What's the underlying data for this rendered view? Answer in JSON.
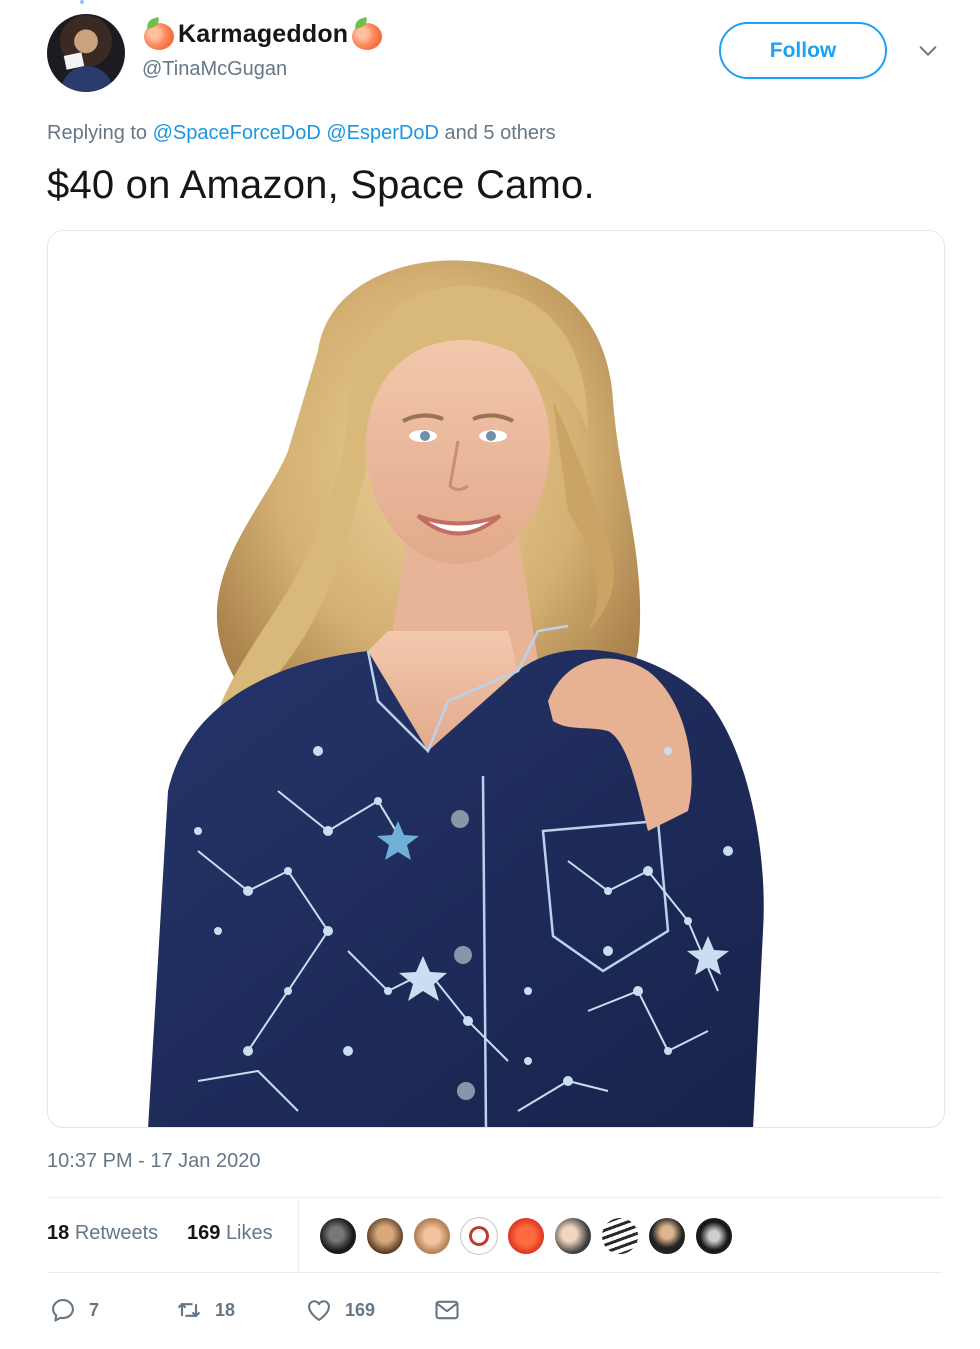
{
  "author": {
    "display_name": "Karmageddon",
    "handle": "@TinaMcGugan",
    "name_emoji": "peach-icon"
  },
  "follow_button": {
    "label": "Follow"
  },
  "reply_context": {
    "prefix": "Replying to",
    "mentions": [
      "@SpaceForceDoD",
      "@EsperDoD"
    ],
    "suffix": "and 5 others"
  },
  "tweet": {
    "text": "$40 on Amazon, Space Camo.",
    "media_description": "woman-in-navy-star-constellation-pajama-shirt",
    "timestamp": "10:37 PM - 17 Jan 2020"
  },
  "stats": {
    "retweets_count": "18",
    "retweets_label": "Retweets",
    "likes_count": "169",
    "likes_label": "Likes"
  },
  "likers_count_shown": 9,
  "actions": {
    "reply_count": "7",
    "retweet_count": "18",
    "like_count": "169"
  },
  "colors": {
    "accent": "#1da1f2",
    "mention": "#1b95e0",
    "secondary_text": "#657786",
    "pajama_navy": "#1f2d5a"
  }
}
